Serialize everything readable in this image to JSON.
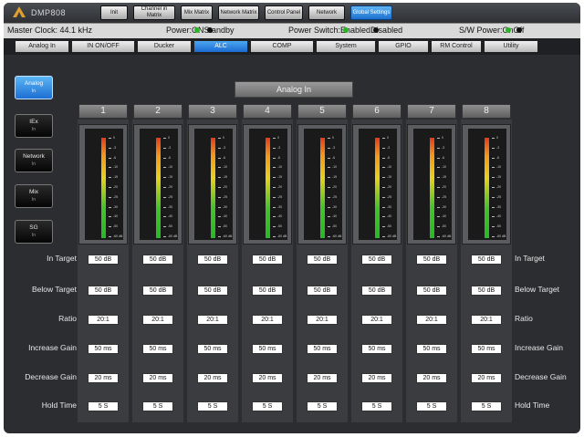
{
  "app": {
    "brand": "DMP808"
  },
  "nav": {
    "items": [
      {
        "label": "Init"
      },
      {
        "label": "Channel in Matrix"
      },
      {
        "label": "Mix Matrix"
      },
      {
        "label": "Network Matrix"
      },
      {
        "label": "Control Panel"
      },
      {
        "label": "Network"
      },
      {
        "label": "Global Settings"
      }
    ],
    "active_index": 6
  },
  "status": {
    "master_clock": "Master Clock: 44.1 kHz",
    "power_label": "Power:",
    "power_on": "ON",
    "power_standby": "Standby",
    "power_switch_label": "Power Switch:",
    "power_switch_enabled": "Enabled",
    "power_switch_disabled": "Disabled",
    "sw_power_label": "S/W Power:",
    "sw_power_on": "On",
    "sw_power_off": "Off"
  },
  "subtabs": {
    "items": [
      {
        "label": "Analog In"
      },
      {
        "label": "IN ON/OFF"
      },
      {
        "label": "Ducker"
      },
      {
        "label": "ALC"
      },
      {
        "label": "COMP"
      },
      {
        "label": "System"
      },
      {
        "label": "GPIO"
      },
      {
        "label": "RM Control"
      },
      {
        "label": "Utility"
      }
    ],
    "active_index": 3
  },
  "side_buttons": [
    {
      "label": "Analog",
      "sub": "In",
      "active": true
    },
    {
      "label": "IEx",
      "sub": "In",
      "active": false
    },
    {
      "label": "Network",
      "sub": "In",
      "active": false
    },
    {
      "label": "Mix",
      "sub": "In",
      "active": false
    },
    {
      "label": "SG",
      "sub": "In",
      "active": false
    }
  ],
  "section_title": "Analog In",
  "meter_ticks": [
    "0",
    "-3",
    "-6",
    "-10",
    "-15",
    "-20",
    "-25",
    "-30",
    "-40",
    "-50",
    "-60 dB"
  ],
  "channels": [
    {
      "name": "1",
      "in_target": "50 dB",
      "below_target": "50 dB",
      "ratio": "20:1",
      "increase_gain": "50 ms",
      "decrease_gain": "20 ms",
      "hold_time": "5 S"
    },
    {
      "name": "2",
      "in_target": "50 dB",
      "below_target": "50 dB",
      "ratio": "20:1",
      "increase_gain": "50 ms",
      "decrease_gain": "20 ms",
      "hold_time": "5 S"
    },
    {
      "name": "3",
      "in_target": "50 dB",
      "below_target": "50 dB",
      "ratio": "20:1",
      "increase_gain": "50 ms",
      "decrease_gain": "20 ms",
      "hold_time": "5 S"
    },
    {
      "name": "4",
      "in_target": "50 dB",
      "below_target": "50 dB",
      "ratio": "20:1",
      "increase_gain": "50 ms",
      "decrease_gain": "20 ms",
      "hold_time": "5 S"
    },
    {
      "name": "5",
      "in_target": "50 dB",
      "below_target": "50 dB",
      "ratio": "20:1",
      "increase_gain": "50 ms",
      "decrease_gain": "20 ms",
      "hold_time": "5 S"
    },
    {
      "name": "6",
      "in_target": "50 dB",
      "below_target": "50 dB",
      "ratio": "20:1",
      "increase_gain": "50 ms",
      "decrease_gain": "20 ms",
      "hold_time": "5 S"
    },
    {
      "name": "7",
      "in_target": "50 dB",
      "below_target": "50 dB",
      "ratio": "20:1",
      "increase_gain": "50 ms",
      "decrease_gain": "20 ms",
      "hold_time": "5 S"
    },
    {
      "name": "8",
      "in_target": "50 dB",
      "below_target": "50 dB",
      "ratio": "20:1",
      "increase_gain": "50 ms",
      "decrease_gain": "20 ms",
      "hold_time": "5 S"
    }
  ],
  "rows": [
    {
      "key": "in_target",
      "label": "In Target"
    },
    {
      "key": "below_target",
      "label": "Below Target"
    },
    {
      "key": "ratio",
      "label": "Ratio"
    },
    {
      "key": "increase_gain",
      "label": "Increase Gain"
    },
    {
      "key": "decrease_gain",
      "label": "Decrease Gain"
    },
    {
      "key": "hold_time",
      "label": "Hold Time"
    }
  ]
}
